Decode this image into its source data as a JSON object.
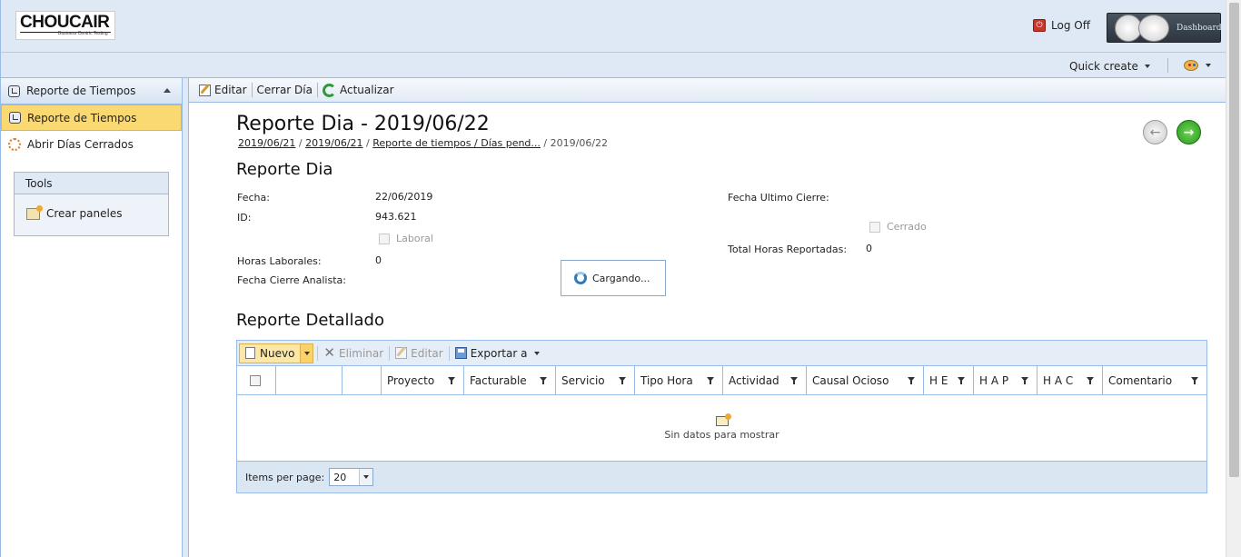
{
  "header": {
    "logo_text": "CHOUCAIR",
    "logo_tagline": "Business Centric Testing",
    "logoff_label": "Log Off",
    "dashboard_label": "Dashboard"
  },
  "subbar": {
    "quick_create_label": "Quick create"
  },
  "sidebar": {
    "panel_title": "Reporte de Tiempos",
    "items": [
      {
        "label": "Reporte de Tiempos",
        "icon": "clock-icon",
        "active": true
      },
      {
        "label": "Abrir Días Cerrados",
        "icon": "gear-icon",
        "active": false
      }
    ],
    "tools": {
      "title": "Tools",
      "item_label": "Crear paneles"
    }
  },
  "toolbar": {
    "edit_label": "Editar",
    "close_day_label": "Cerrar Día",
    "refresh_label": "Actualizar"
  },
  "page": {
    "title": "Reporte Dia - 2019/06/22",
    "breadcrumb": [
      {
        "label": "2019/06/21",
        "link": true
      },
      {
        "label": "2019/06/21",
        "link": true
      },
      {
        "label": "Reporte de tiempos / Días pend...",
        "link": true
      },
      {
        "label": "2019/06/22",
        "link": false
      }
    ],
    "breadcrumb_sep": "/"
  },
  "reporte_dia": {
    "section_title": "Reporte Dia",
    "fecha_label": "Fecha:",
    "fecha_value": "22/06/2019",
    "id_label": "ID:",
    "id_value": "943.621",
    "laboral_label": "Laboral",
    "horas_laborales_label": "Horas Laborales:",
    "horas_laborales_value": "0",
    "fecha_cierre_analista_label": "Fecha Cierre Analista:",
    "fecha_ultimo_cierre_label": "Fecha Ultimo Cierre:",
    "cerrado_label": "Cerrado",
    "total_horas_label": "Total Horas Reportadas:",
    "total_horas_value": "0",
    "loading_label": "Cargando..."
  },
  "reporte_detallado": {
    "section_title": "Reporte Detallado",
    "toolbar": {
      "new_label": "Nuevo",
      "delete_label": "Eliminar",
      "edit_label": "Editar",
      "export_label": "Exportar a"
    },
    "columns": [
      "Proyecto",
      "Facturable",
      "Servicio",
      "Tipo Hora",
      "Actividad",
      "Causal Ocioso",
      "H E",
      "H A P",
      "H A C",
      "Comentario"
    ],
    "empty_message": "Sin datos para mostrar",
    "items_per_page_label": "Items per page:",
    "page_size": "20"
  }
}
